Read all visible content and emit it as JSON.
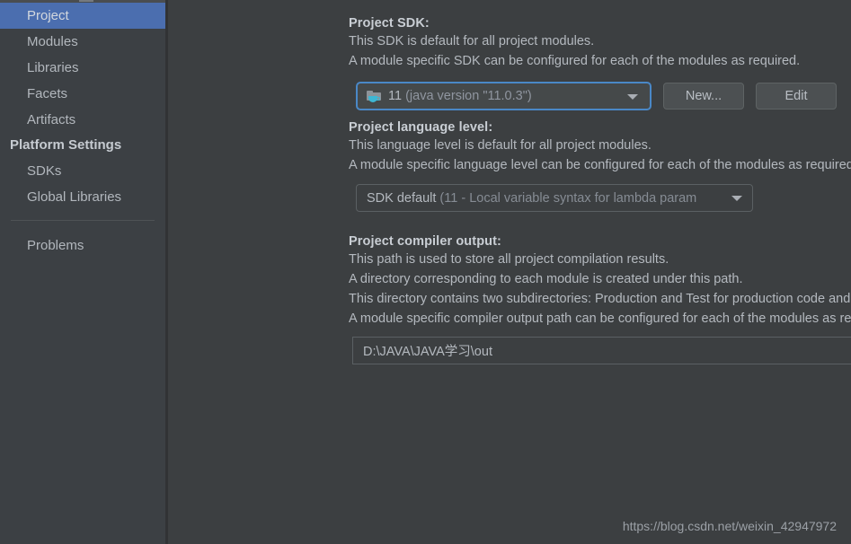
{
  "sidebar": {
    "items": [
      {
        "label": "Project",
        "type": "item",
        "selected": true
      },
      {
        "label": "Modules",
        "type": "item",
        "selected": false
      },
      {
        "label": "Libraries",
        "type": "item",
        "selected": false
      },
      {
        "label": "Facets",
        "type": "item",
        "selected": false
      },
      {
        "label": "Artifacts",
        "type": "item",
        "selected": false
      },
      {
        "label": "Platform Settings",
        "type": "group",
        "selected": false
      },
      {
        "label": "SDKs",
        "type": "item",
        "selected": false
      },
      {
        "label": "Global Libraries",
        "type": "item",
        "selected": false
      },
      {
        "label": "Problems",
        "type": "item",
        "selected": false
      }
    ]
  },
  "project_sdk": {
    "title": "Project SDK:",
    "desc_line1": "This SDK is default for all project modules.",
    "desc_line2": "A module specific SDK can be configured for each of the modules as required.",
    "combo": {
      "icon": "java-sdk-folder-icon",
      "name": "11",
      "version": "(java version \"11.0.3\")"
    },
    "new_button": "New...",
    "edit_button": "Edit"
  },
  "language_level": {
    "title": "Project language level:",
    "desc_line1": "This language level is default for all project modules.",
    "desc_line2": "A module specific language level can be configured for each of the modules as required.",
    "combo": {
      "value": "SDK default",
      "detail": "(11 - Local variable syntax for lambda param"
    }
  },
  "compiler_output": {
    "title": "Project compiler output:",
    "desc_line1": "This path is used to store all project compilation results.",
    "desc_line2": "A directory corresponding to each module is created under this path.",
    "desc_line3": "This directory contains two subdirectories: Production and Test for production code and test sources, r",
    "desc_line4": "A module specific compiler output path can be configured for each of the modules as required.",
    "path_value": "D:\\JAVA\\JAVA学习\\out"
  },
  "watermark": {
    "text": "https://blog.csdn.net/weixin_42947972"
  },
  "colors": {
    "background": "#3c3f41",
    "sidebar": "#3c4044",
    "selection": "#4b6eaf",
    "focus_border": "#4a88c7",
    "text": "#b4b9bf",
    "text_muted": "#868c94",
    "accent_cup": "#3eb7d4"
  }
}
